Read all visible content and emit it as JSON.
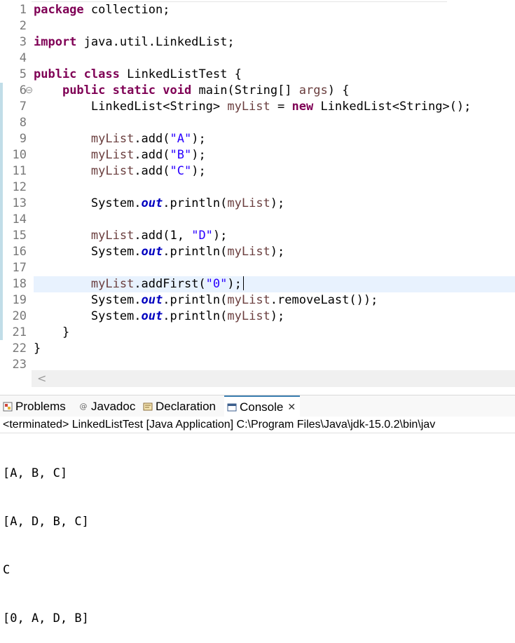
{
  "editor": {
    "lines": [
      {
        "n": "1",
        "html": "<span class=\"kw\">package</span> collection;"
      },
      {
        "n": "2",
        "html": ""
      },
      {
        "n": "3",
        "html": "<span class=\"kw\">import</span> java.util.LinkedList;"
      },
      {
        "n": "4",
        "html": ""
      },
      {
        "n": "5",
        "html": "<span class=\"kw\">public</span> <span class=\"kw\">class</span> LinkedListTest {"
      },
      {
        "n": "6",
        "html": "    <span class=\"kw\">public</span> <span class=\"kw\">static</span> <span class=\"kw\">void</span> main(String[] <span class=\"var\">args</span>) {"
      },
      {
        "n": "7",
        "html": "        LinkedList&lt;String&gt; <span class=\"var\">myList</span> = <span class=\"kw\">new</span> LinkedList&lt;String&gt;();"
      },
      {
        "n": "8",
        "html": ""
      },
      {
        "n": "9",
        "html": "        <span class=\"var\">myList</span>.add(<span class=\"str\">\"A\"</span>);"
      },
      {
        "n": "10",
        "html": "        <span class=\"var\">myList</span>.add(<span class=\"str\">\"B\"</span>);"
      },
      {
        "n": "11",
        "html": "        <span class=\"var\">myList</span>.add(<span class=\"str\">\"C\"</span>);"
      },
      {
        "n": "12",
        "html": ""
      },
      {
        "n": "13",
        "html": "        System.<span class=\"fld\">out</span>.println(<span class=\"var\">myList</span>);"
      },
      {
        "n": "14",
        "html": ""
      },
      {
        "n": "15",
        "html": "        <span class=\"var\">myList</span>.add(1, <span class=\"str\">\"D\"</span>);"
      },
      {
        "n": "16",
        "html": "        System.<span class=\"fld\">out</span>.println(<span class=\"var\">myList</span>);"
      },
      {
        "n": "17",
        "html": ""
      },
      {
        "n": "18",
        "html": "        <span class=\"var\">myList</span>.addFirst(<span class=\"str\">\"0\"</span>);<span class=\"caret\"></span>"
      },
      {
        "n": "19",
        "html": "        System.<span class=\"fld\">out</span>.println(<span class=\"var\">myList</span>.removeLast());"
      },
      {
        "n": "20",
        "html": "        System.<span class=\"fld\">out</span>.println(<span class=\"var\">myList</span>);"
      },
      {
        "n": "21",
        "html": "    }"
      },
      {
        "n": "22",
        "html": "}"
      },
      {
        "n": "23",
        "html": ""
      }
    ],
    "fold_marker_line": "6",
    "current_line": "18"
  },
  "hscroll": {
    "left_arrow": "<"
  },
  "tabs": [
    {
      "name": "tab-problems",
      "icon": "problems-icon",
      "label": "Problems"
    },
    {
      "name": "tab-javadoc",
      "icon": "javadoc-icon",
      "label": "Javadoc"
    },
    {
      "name": "tab-declaration",
      "icon": "declaration-icon",
      "label": "Declaration"
    },
    {
      "name": "tab-console",
      "icon": "console-icon",
      "label": "Console",
      "active": true
    }
  ],
  "console": {
    "header": "<terminated> LinkedListTest [Java Application] C:\\Program Files\\Java\\jdk-15.0.2\\bin\\jav",
    "output": [
      "[A, B, C]",
      "[A, D, B, C]",
      "C",
      "[0, A, D, B]"
    ]
  },
  "colors": {
    "keyword": "#7f0055",
    "string": "#2a00ff",
    "local_var": "#6a3e3e",
    "static_field": "#0000c0",
    "current_line": "#e8f2fe"
  }
}
